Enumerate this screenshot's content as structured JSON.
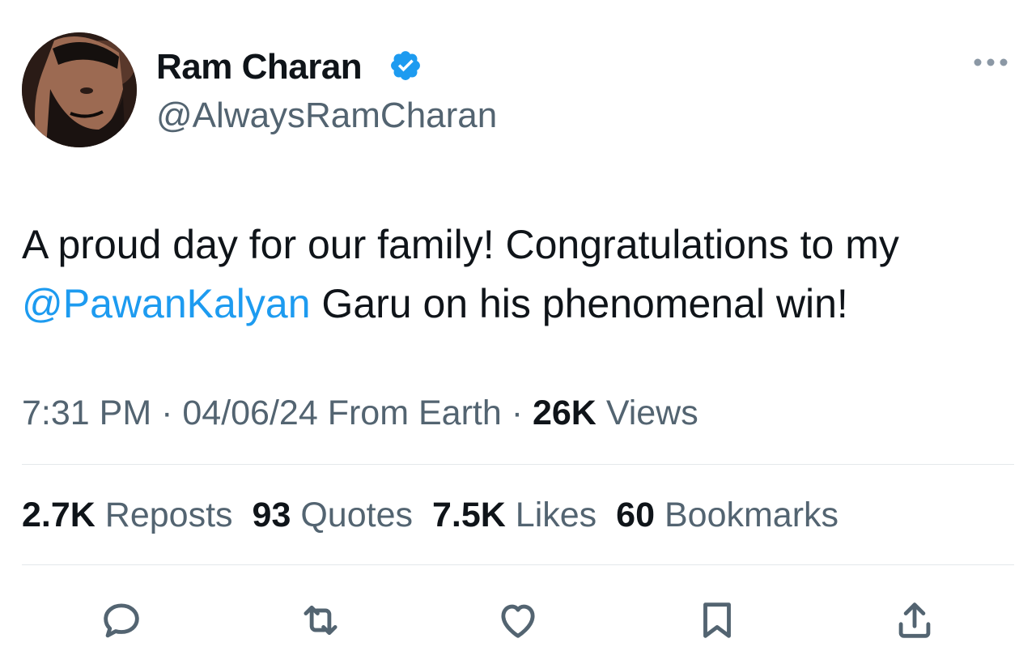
{
  "author": {
    "display_name": "Ram Charan",
    "handle": "@AlwaysRamCharan",
    "verified_icon": "verified-badge-icon",
    "avatar_icon": "profile-avatar"
  },
  "more_icon": "more-horizontal-icon",
  "tweet": {
    "text_before": "A proud day for our family! Congratulations to my ",
    "mention": "@PawanKalyan",
    "text_after": " Garu on his phenomenal win!"
  },
  "meta": {
    "time": "7:31 PM",
    "date": "04/06/24",
    "source": "From Earth",
    "views_count": "26K",
    "views_label": "Views",
    "separator": " · "
  },
  "stats": [
    {
      "count": "2.7K",
      "label": "Reposts"
    },
    {
      "count": "93",
      "label": "Quotes"
    },
    {
      "count": "7.5K",
      "label": "Likes"
    },
    {
      "count": "60",
      "label": "Bookmarks"
    }
  ],
  "actions": [
    {
      "name": "reply",
      "icon": "reply-icon"
    },
    {
      "name": "repost",
      "icon": "repost-icon"
    },
    {
      "name": "like",
      "icon": "heart-icon"
    },
    {
      "name": "bookmark",
      "icon": "bookmark-icon"
    },
    {
      "name": "share",
      "icon": "share-icon"
    }
  ],
  "colors": {
    "accent": "#1d9bf0",
    "text_primary": "#0f1419",
    "text_secondary": "#536471",
    "divider": "#e4e8eb"
  }
}
